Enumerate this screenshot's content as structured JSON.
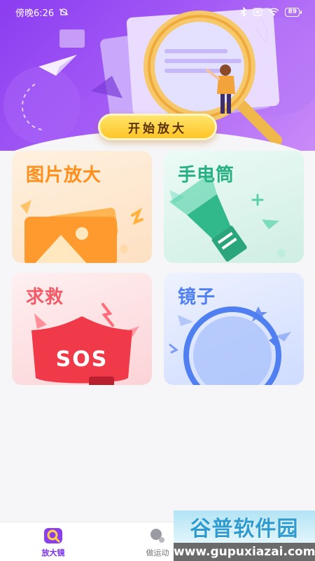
{
  "status_bar": {
    "time": "傍晚6:26",
    "battery": "89"
  },
  "hero": {
    "start_button_label": "开始放大"
  },
  "cards": [
    {
      "id": "picture",
      "title": "图片放大",
      "color": "#ff8f1c"
    },
    {
      "id": "flashlight",
      "title": "手电筒",
      "color": "#27b084"
    },
    {
      "id": "sos",
      "title": "求救",
      "color": "#f15a66",
      "badge": "SOS"
    },
    {
      "id": "mirror",
      "title": "镜子",
      "color": "#4f7ff1"
    }
  ],
  "bottom_nav": {
    "items": [
      {
        "label": "放大镜",
        "active": true
      },
      {
        "label": "做运动",
        "active": false
      }
    ]
  },
  "watermark": {
    "title": "谷普软件园",
    "url": "www.gupuxiazai.com"
  },
  "colors": {
    "brand_purple": "#8b3df0",
    "button_yellow": "#ffc526"
  }
}
